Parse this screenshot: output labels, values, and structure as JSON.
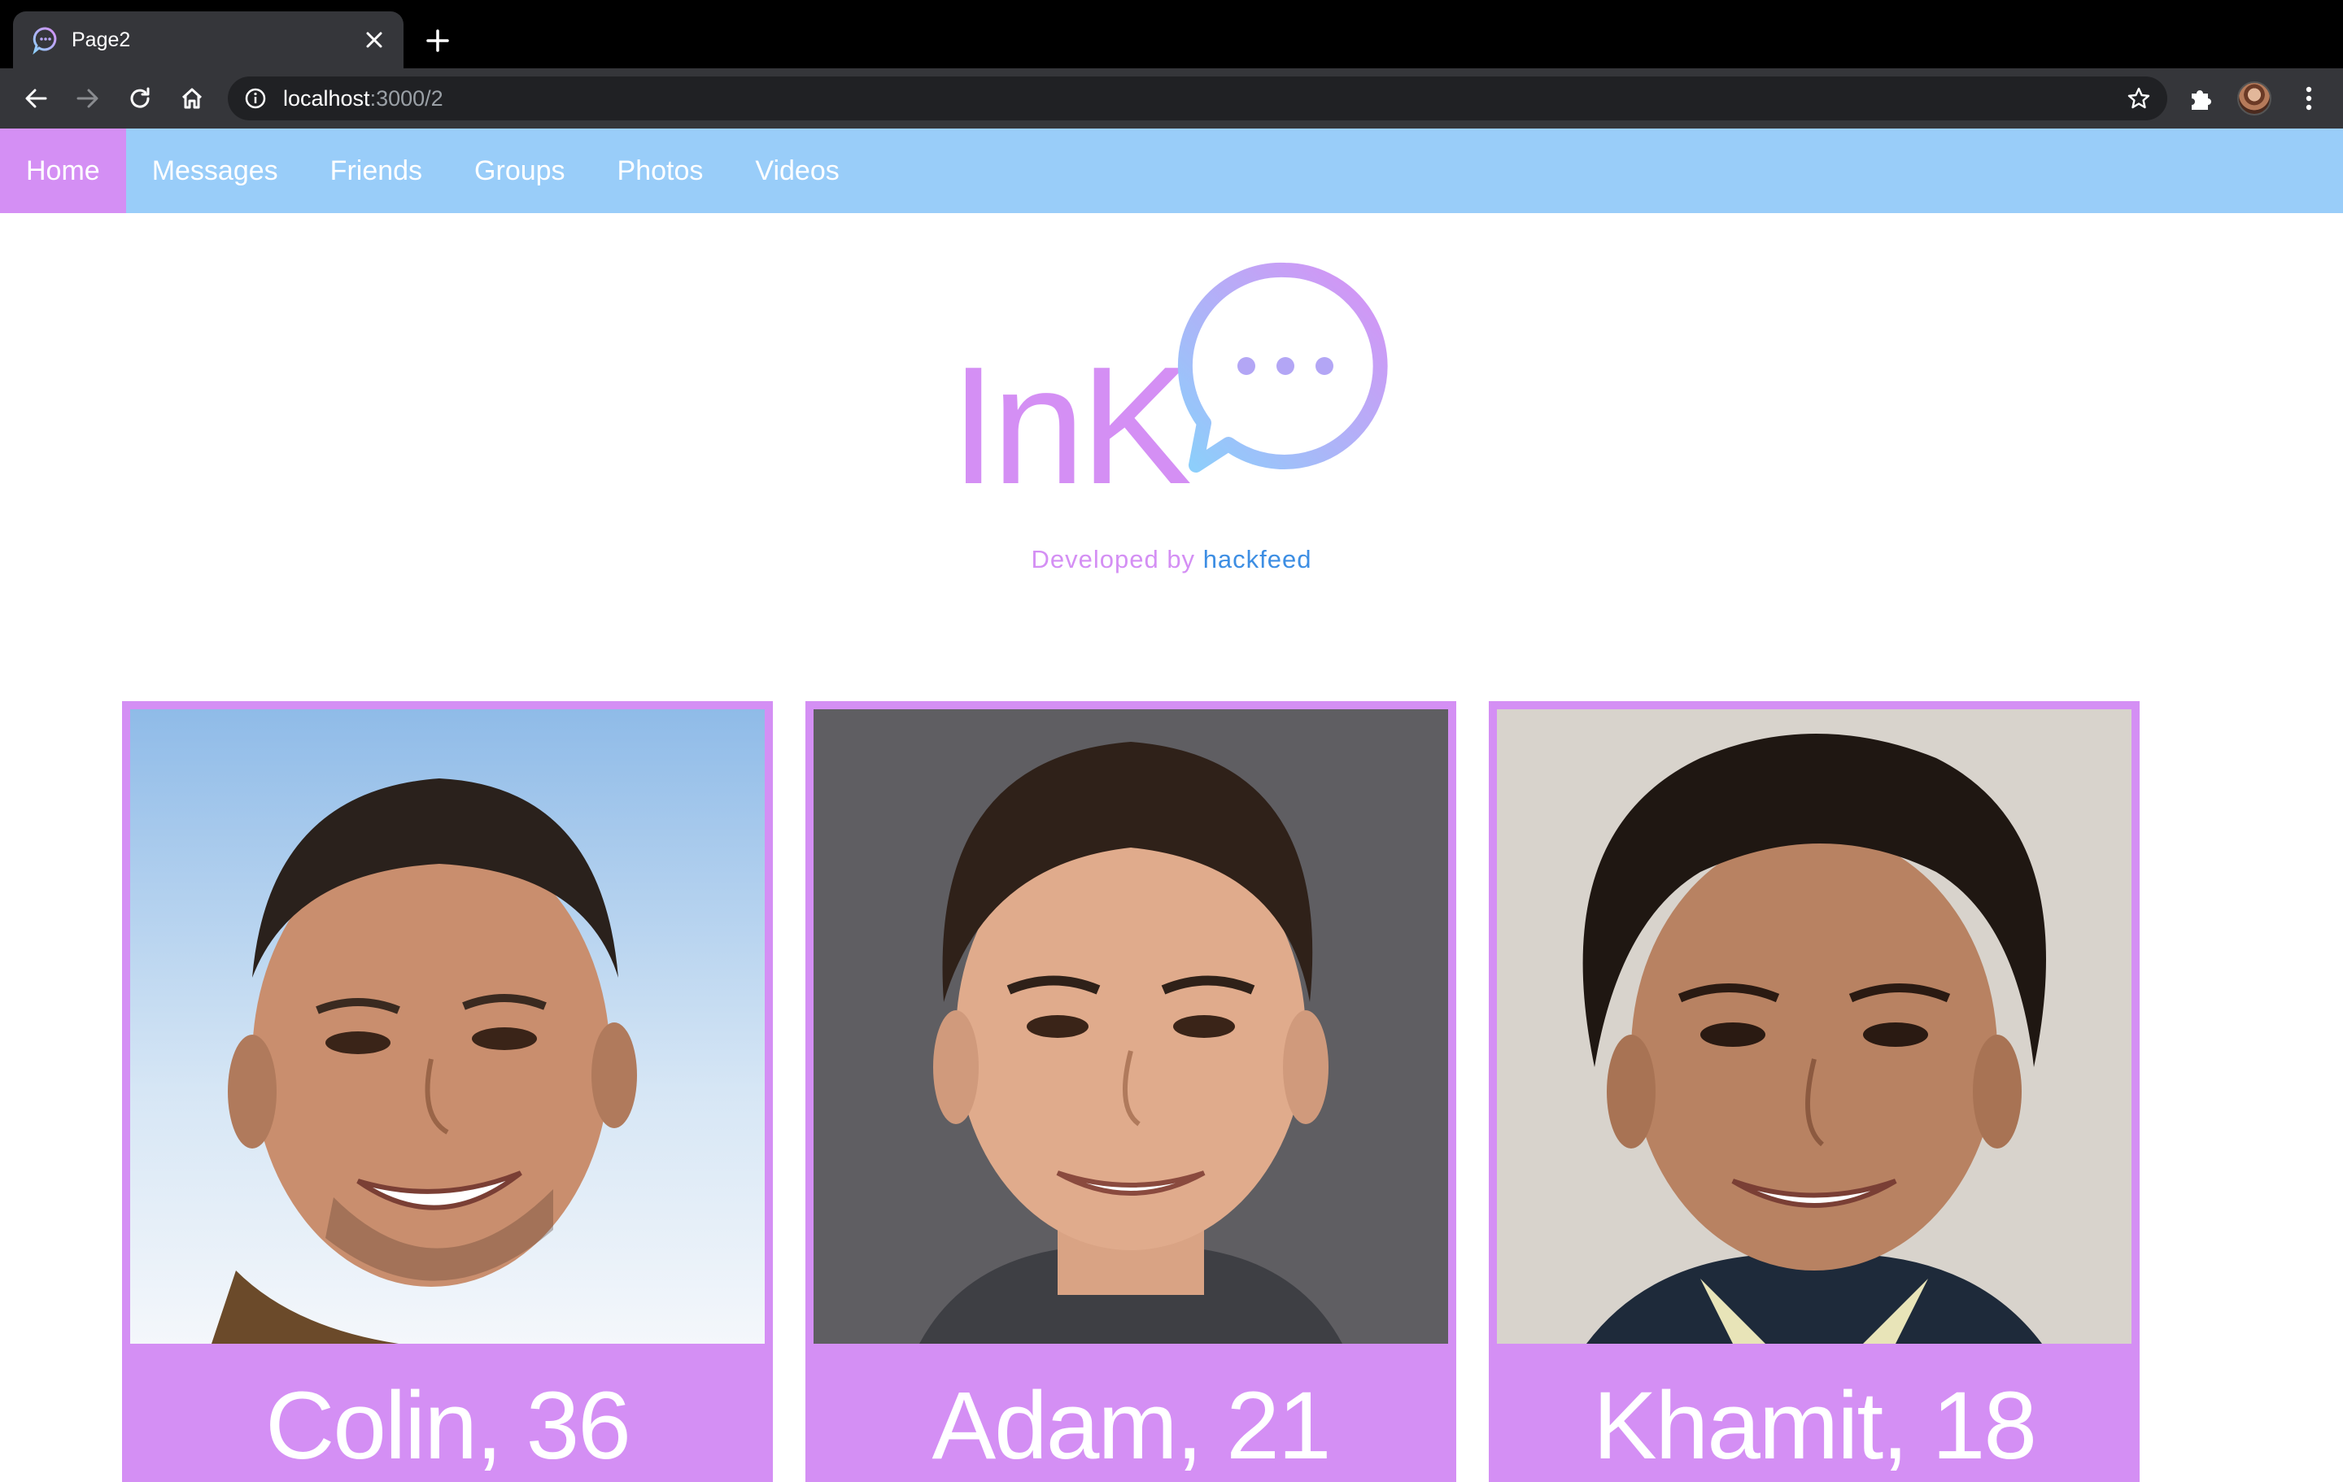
{
  "browser": {
    "tab_title": "Page2",
    "url_host": "localhost",
    "url_path": ":3000/2"
  },
  "nav": {
    "items": [
      {
        "label": "Home",
        "active": true
      },
      {
        "label": "Messages",
        "active": false
      },
      {
        "label": "Friends",
        "active": false
      },
      {
        "label": "Groups",
        "active": false
      },
      {
        "label": "Photos",
        "active": false
      },
      {
        "label": "Videos",
        "active": false
      }
    ]
  },
  "logo": {
    "text": "InK"
  },
  "credit": {
    "prefix": "Developed by",
    "link": "hackfeed"
  },
  "profiles": [
    {
      "name": "Colin, 36",
      "photo": "man-smiling-outdoor-sky"
    },
    {
      "name": "Adam, 21",
      "photo": "young-man-grey-background"
    },
    {
      "name": "Khamit, 18",
      "photo": "boy-curly-hair-smiling"
    }
  ],
  "colors": {
    "accent": "#d48ff4",
    "nav_bg": "#99cdf9",
    "link": "#3d8ee3",
    "tab_bg": "#35363a",
    "omnibox_bg": "#202124"
  },
  "icons": {
    "favicon": "chat-bubble-icon",
    "back": "arrow-left-icon",
    "forward": "arrow-right-icon",
    "reload": "reload-icon",
    "home": "home-icon",
    "info": "info-icon",
    "star": "star-icon",
    "extensions": "puzzle-icon",
    "menu": "kebab-menu-icon"
  }
}
